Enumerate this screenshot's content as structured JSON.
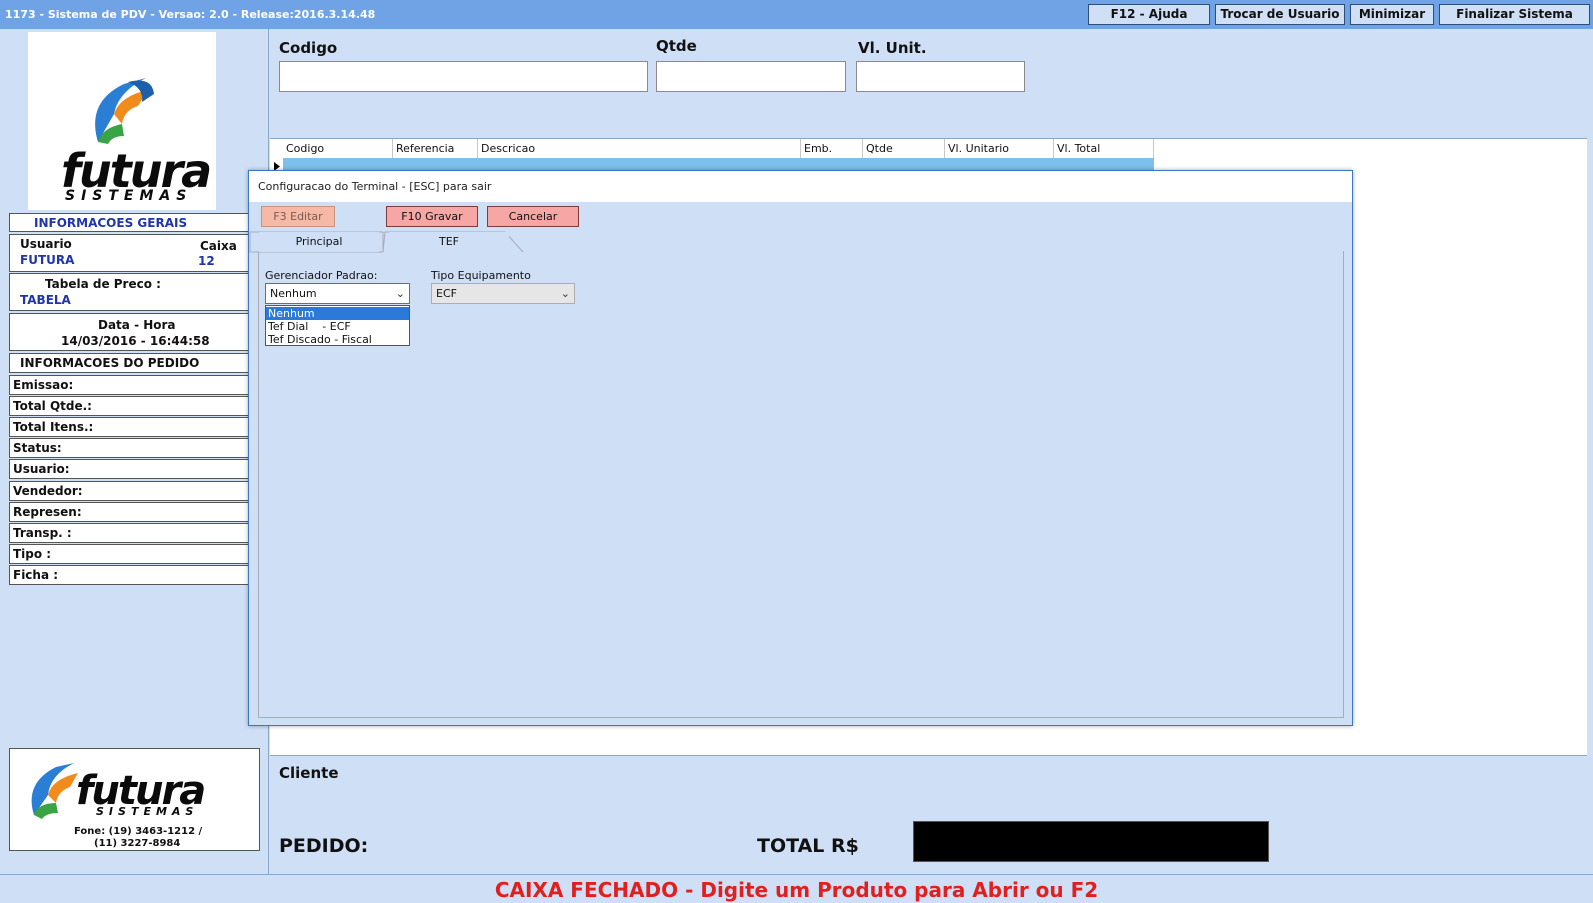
{
  "window": {
    "title": "1173 - Sistema de PDV - Versao: 2.0 - Release:2016.3.14.48"
  },
  "titlebar_buttons": [
    "F12 - Ajuda",
    "Trocar de Usuario",
    "Minimizar",
    "Finalizar Sistema"
  ],
  "logo": {
    "line1": "futura",
    "line2": "SISTEMAS"
  },
  "info_gerais": {
    "header": "INFORMACOES GERAIS",
    "usuario_label": "Usuario",
    "usuario_value": "FUTURA",
    "caixa_label": "Caixa",
    "caixa_value": "12",
    "tabela_label": "Tabela de Preco :",
    "tabela_value": "TABELA",
    "datahora_label": "Data - Hora",
    "datahora_value": "14/03/2016 - 16:44:58"
  },
  "info_pedido": {
    "header": "INFORMACOES DO PEDIDO",
    "rows": [
      "Emissao:",
      "Total Qtde.:",
      "Total Itens.:",
      "Status:",
      "Usuario:",
      "Vendedor:",
      "Represen:",
      "Transp. :",
      "Tipo :",
      "Ficha :"
    ]
  },
  "footer_logo": {
    "line1": "futura",
    "line2": "SISTEMAS",
    "phone1": "Fone: (19) 3463-1212 /",
    "phone2": "(11) 3227-8984"
  },
  "entry": {
    "codigo_label": "Codigo",
    "qtde_label": "Qtde",
    "vlunit_label": "Vl. Unit."
  },
  "grid": {
    "columns": [
      "Codigo",
      "Referencia",
      "Descricao",
      "Emb.",
      "Qtde",
      "Vl. Unitario",
      "Vl. Total"
    ]
  },
  "bottom": {
    "cliente_label": "Cliente",
    "pedido_label": "PEDIDO:",
    "total_label": "TOTAL R$"
  },
  "status": "CAIXA FECHADO - Digite um Produto para Abrir ou F2",
  "dialog": {
    "title": "Configuracao do Terminal - [ESC] para sair",
    "buttons": {
      "editar": "F3 Editar",
      "gravar": "F10 Gravar",
      "cancelar": "Cancelar"
    },
    "tabs": [
      "Principal",
      "TEF"
    ],
    "active_tab": "TEF",
    "gerenciador_label": "Gerenciador Padrao:",
    "gerenciador_value": "Nenhum",
    "gerenciador_options": [
      "Nenhum",
      "Tef Dial    - ECF",
      "Tef Discado - Fiscal"
    ],
    "tipo_label": "Tipo Equipamento",
    "tipo_value": "ECF"
  },
  "colors": {
    "titlebar": "#6fa3e6",
    "background": "#cfe0f6",
    "status_text": "#e21f1f",
    "info_value": "#1f35a8"
  }
}
